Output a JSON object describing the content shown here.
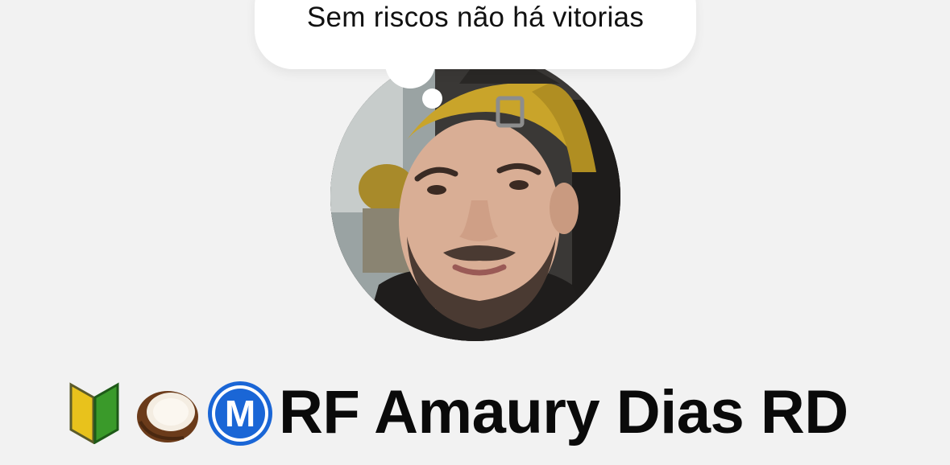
{
  "note": {
    "text": "Sem riscos não há vitorias"
  },
  "profile": {
    "name": "RF Amaury Dias RD",
    "name_prefix_icons": [
      "beginner-symbol-icon",
      "coconut-icon",
      "circled-m-icon"
    ]
  },
  "colors": {
    "background": "#f2f2f2",
    "bubble": "#ffffff",
    "text": "#0a0a0a",
    "cap_yellow": "#c9a42a",
    "m_badge_blue": "#1a66d6"
  }
}
